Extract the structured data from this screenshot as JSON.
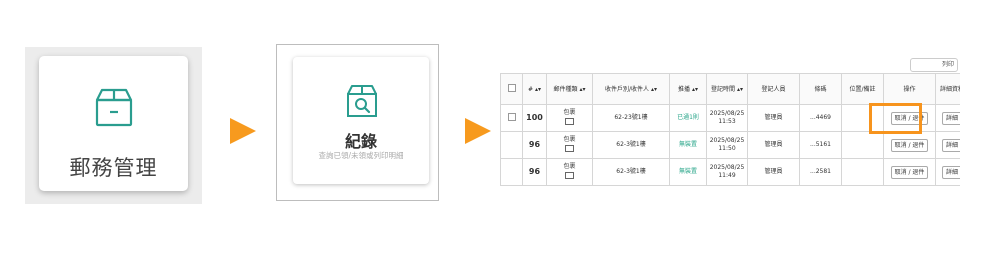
{
  "step1": {
    "title": "郵務管理",
    "icon": "box-icon"
  },
  "step2": {
    "title": "紀錄",
    "subtitle": "查詢已領/未領或列印明細",
    "icon": "box-search-icon"
  },
  "accent_color": "#f79a1e",
  "brand_color": "#2aa68a",
  "table": {
    "print_label": "列印",
    "headers": [
      "",
      "# ▴▾",
      "郵件種類 ▴▾",
      "收件戶別/收件人 ▴▾",
      "推播 ▴▾",
      "登記時間 ▴▾",
      "登記人員",
      "條碼",
      "位置/備註",
      "操作",
      "詳細資料"
    ],
    "rows": [
      {
        "num": "100",
        "type": "包裹",
        "recipient": "62-23號1樓",
        "push": "已通1則",
        "date": "2025/08/25",
        "time": "11:53",
        "staff": "管理員",
        "barcode": "...4469",
        "location": "",
        "action": "取消 / 退件",
        "detail": "詳細",
        "checkbox": true
      },
      {
        "num": "96",
        "type": "包裹",
        "recipient": "62-3號1樓",
        "push": "無裝置",
        "date": "2025/08/25",
        "time": "11:50",
        "staff": "管理員",
        "barcode": "...5161",
        "location": "",
        "action": "取消 / 退件",
        "detail": "詳細",
        "checkbox": false
      },
      {
        "num": "96",
        "type": "包裹",
        "recipient": "62-3號1樓",
        "push": "無裝置",
        "date": "2025/08/25",
        "time": "11:49",
        "staff": "管理員",
        "barcode": "...2581",
        "location": "",
        "action": "取消 / 退件",
        "detail": "詳細",
        "checkbox": false
      }
    ]
  }
}
